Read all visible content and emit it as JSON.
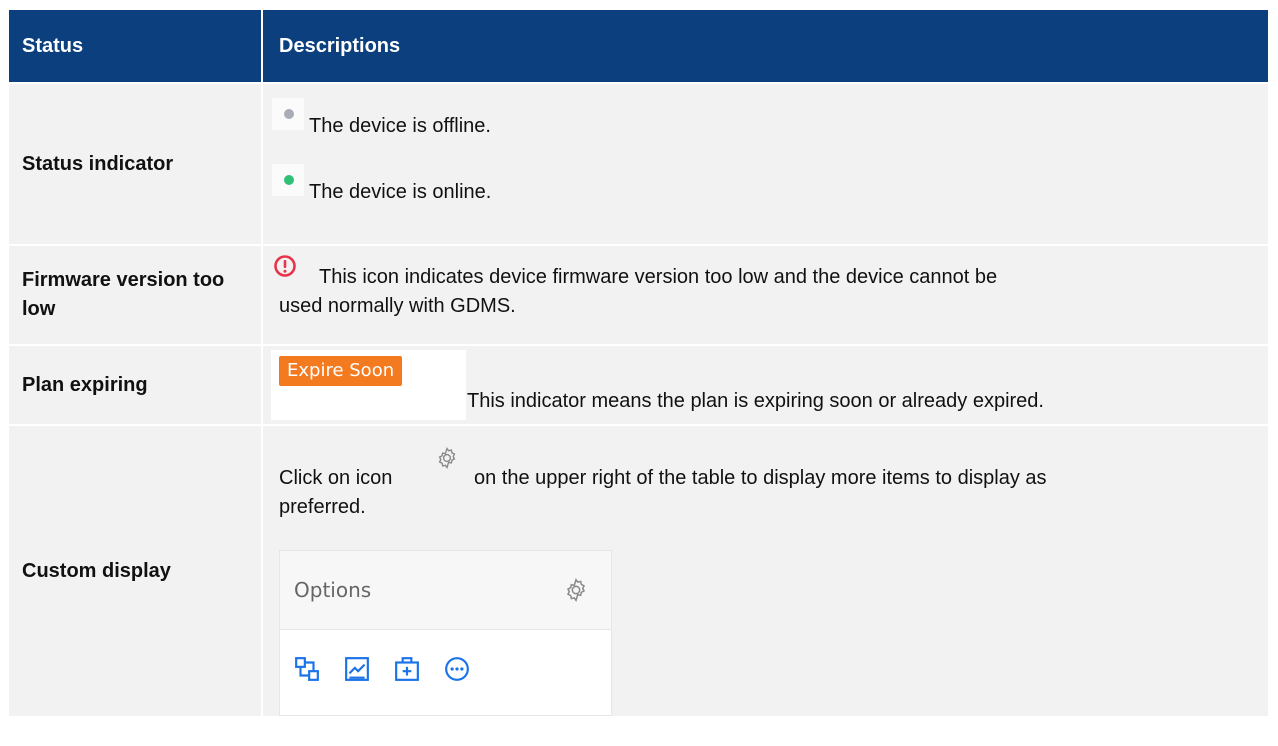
{
  "header": {
    "col_status": "Status",
    "col_descriptions": "Descriptions"
  },
  "rows": [
    {
      "status": "Status indicator",
      "lines": [
        "The device is offline.",
        "The device is online."
      ]
    },
    {
      "status": "Firmware version too low",
      "lines": [
        "This icon indicates device firmware version too low and the device cannot be",
        "used normally with GDMS."
      ]
    },
    {
      "status": "Plan expiring",
      "badge": "Expire Soon",
      "lines": [
        "This indicator means the plan is expiring soon or already expired."
      ]
    },
    {
      "status": "Custom display",
      "lines": [
        "Click on icon",
        "on the upper right of the table to display more items to display as",
        "preferred."
      ],
      "options_label": "Options"
    }
  ],
  "colors": {
    "header_bg": "#0c3f7d",
    "row_bg": "#f2f2f2",
    "offline": "#a9adb5",
    "online": "#2fc276",
    "warning": "#e8344a",
    "badge": "#f47a20",
    "icon_blue": "#1a73e8"
  },
  "icons": [
    "offline-dot-icon",
    "online-dot-icon",
    "warning-circle-icon",
    "gear-icon",
    "topology-icon",
    "chart-icon",
    "add-box-icon",
    "more-circle-icon"
  ]
}
